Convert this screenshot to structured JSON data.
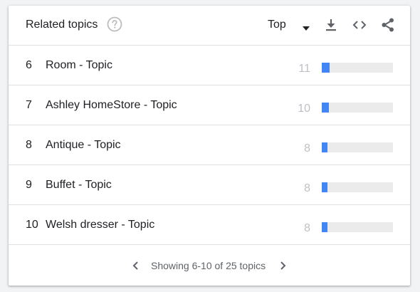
{
  "header": {
    "title": "Related topics",
    "help_icon": "help-circle-icon",
    "dropdown_value": "Top",
    "icons": [
      "download-icon",
      "embed-code-icon",
      "share-icon"
    ]
  },
  "rows": [
    {
      "rank": "6",
      "name": "Room - Topic",
      "value": "11",
      "level": 11
    },
    {
      "rank": "7",
      "name": "Ashley HomeStore - Topic",
      "value": "10",
      "level": 10
    },
    {
      "rank": "8",
      "name": "Antique - Topic",
      "value": "8",
      "level": 8
    },
    {
      "rank": "9",
      "name": "Buffet - Topic",
      "value": "8",
      "level": 8
    },
    {
      "rank": "10",
      "name": "Welsh dresser - Topic",
      "value": "8",
      "level": 8
    }
  ],
  "footer": {
    "pager_text": "Showing 6-10 of 25 topics"
  },
  "colors": {
    "accent": "#4285f4",
    "track": "#ebebeb",
    "value_text": "#bdc1c6",
    "icon": "#5f6368"
  }
}
